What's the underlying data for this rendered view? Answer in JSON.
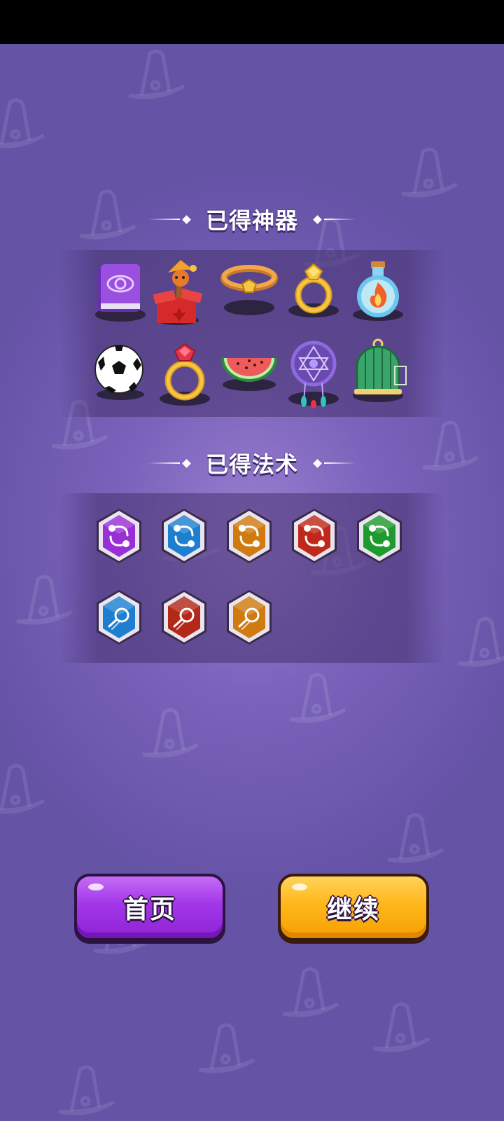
{
  "artifacts_section": {
    "title": "已得神器",
    "items": [
      {
        "name": "spell-book"
      },
      {
        "name": "jack-in-the-box"
      },
      {
        "name": "gold-bracelet"
      },
      {
        "name": "diamond-ring"
      },
      {
        "name": "fire-potion"
      },
      {
        "name": "soccer-ball"
      },
      {
        "name": "ruby-ring"
      },
      {
        "name": "watermelon"
      },
      {
        "name": "dreamcatcher"
      },
      {
        "name": "birdcage"
      }
    ]
  },
  "spells_section": {
    "title": "已得法术",
    "spells": [
      {
        "name": "swap-spell-purple",
        "color": "#9b2fd6"
      },
      {
        "name": "swap-spell-blue",
        "color": "#1e7fd0"
      },
      {
        "name": "swap-spell-orange",
        "color": "#d07a10"
      },
      {
        "name": "swap-spell-red",
        "color": "#c0281a"
      },
      {
        "name": "swap-spell-green",
        "color": "#1f9a2e"
      },
      {
        "name": "comet-spell-blue",
        "color": "#1e7fd0"
      },
      {
        "name": "comet-spell-red",
        "color": "#b4281a"
      },
      {
        "name": "comet-spell-orange",
        "color": "#d07a10"
      }
    ]
  },
  "buttons": {
    "home_label": "首页",
    "continue_label": "继续"
  },
  "colors": {
    "background": "#7a63bb",
    "home_button": "#a236e8",
    "continue_button": "#ffb71a"
  }
}
